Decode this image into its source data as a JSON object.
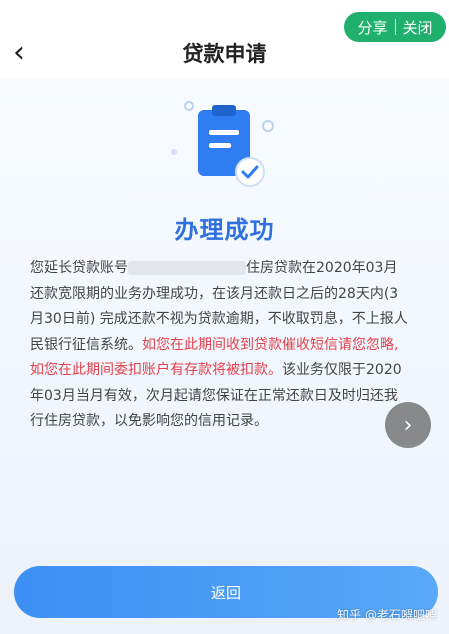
{
  "header": {
    "title": "贷款申请",
    "back_icon": "chevron-left-icon"
  },
  "capsule": {
    "share_label": "分享",
    "close_label": "关闭"
  },
  "result": {
    "title": "办理成功",
    "illustration_icon": "clipboard-check-icon"
  },
  "message": {
    "p1_a": "您延长贷款账号",
    "p1_b": "住房贷款在2020年03月还款宽限期的业务办理成功，在该月还款日之后的28天内(3月30日前) 完成还款不视为贷款逾期，不收取罚息，不上报人民银行征信系统。",
    "highlight": "如您在此期间收到贷款催收短信请您忽略,如您在此期间委扣账户有存款将被扣款。",
    "p2": "该业务仅限于2020年03月当月有效，次月起请您保证在正常还款日及时归还我行住房贷款，以免影响您的信用记录。"
  },
  "actions": {
    "return_label": "返回",
    "next_icon": "chevron-right-icon"
  },
  "watermark": "知乎 @老石嘚吧嘚",
  "colors": {
    "accent": "#2f6fe0",
    "warning": "#e3414d",
    "capsule": "#1fb06e",
    "button": "#4d9cf6"
  }
}
